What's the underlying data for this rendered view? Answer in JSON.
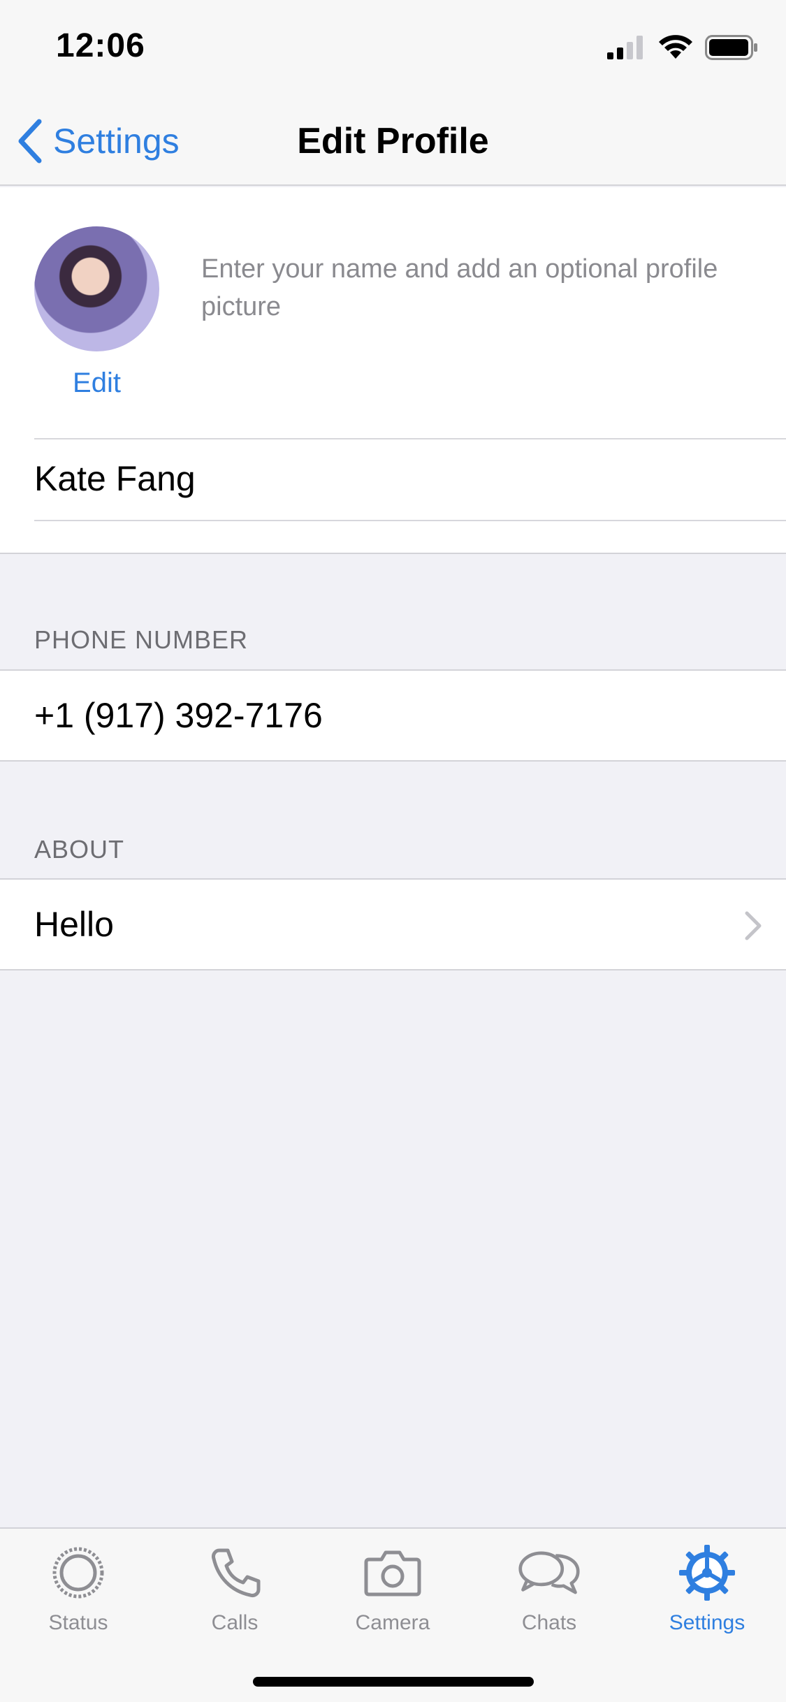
{
  "status_bar": {
    "time": "12:06"
  },
  "nav": {
    "back_label": "Settings",
    "title": "Edit Profile"
  },
  "profile": {
    "avatar_edit_label": "Edit",
    "hint": "Enter your name and add an optional profile picture",
    "name_value": "Kate Fang"
  },
  "phone": {
    "header": "PHONE NUMBER",
    "value": "+1 (917) 392-7176"
  },
  "about": {
    "header": "ABOUT",
    "value": "Hello"
  },
  "tab_bar": {
    "tabs": [
      {
        "label": "Status",
        "icon": "status-icon",
        "active": false
      },
      {
        "label": "Calls",
        "icon": "phone-icon",
        "active": false
      },
      {
        "label": "Camera",
        "icon": "camera-icon",
        "active": false
      },
      {
        "label": "Chats",
        "icon": "chat-bubbles-icon",
        "active": false
      },
      {
        "label": "Settings",
        "icon": "gear-icon",
        "active": true
      }
    ]
  },
  "colors": {
    "accent": "#2f7fe0",
    "background": "#f1f1f6",
    "inactive_tab": "#8e8e93"
  }
}
